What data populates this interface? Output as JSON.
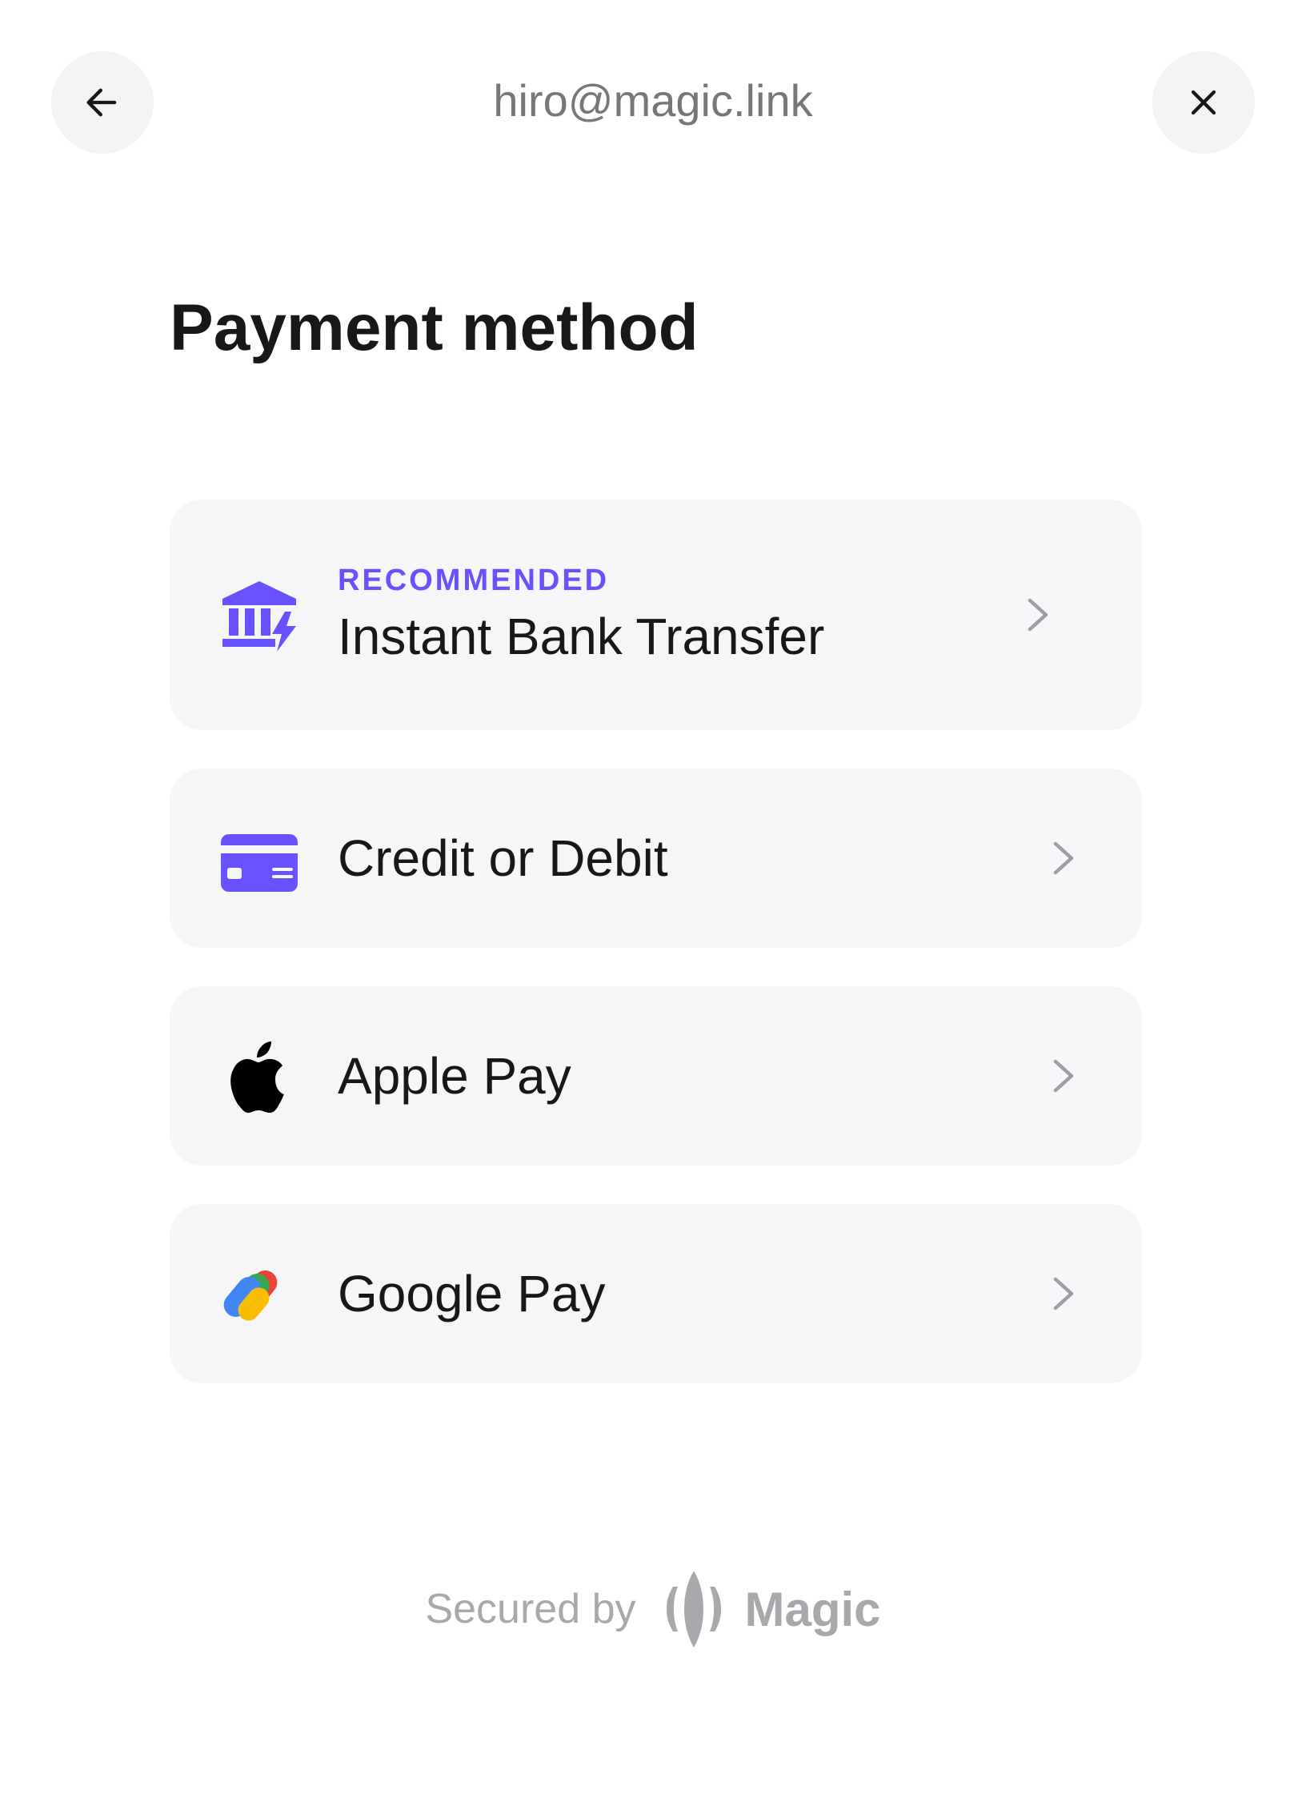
{
  "header": {
    "email": "hiro@magic.link",
    "back_icon": "arrow-left-icon",
    "close_icon": "close-icon"
  },
  "page": {
    "title": "Payment method"
  },
  "options": [
    {
      "tag": "RECOMMENDED",
      "label": "Instant Bank Transfer",
      "icon": "bank-instant-icon"
    },
    {
      "label": "Credit or Debit",
      "icon": "credit-card-icon"
    },
    {
      "label": "Apple Pay",
      "icon": "apple-icon"
    },
    {
      "label": "Google Pay",
      "icon": "google-pay-icon"
    }
  ],
  "footer": {
    "secured_by": "Secured by",
    "brand": "Magic"
  },
  "colors": {
    "accent": "#6851ff",
    "card_background": "#f6f6f8",
    "muted_text": "#a8a8ad"
  }
}
